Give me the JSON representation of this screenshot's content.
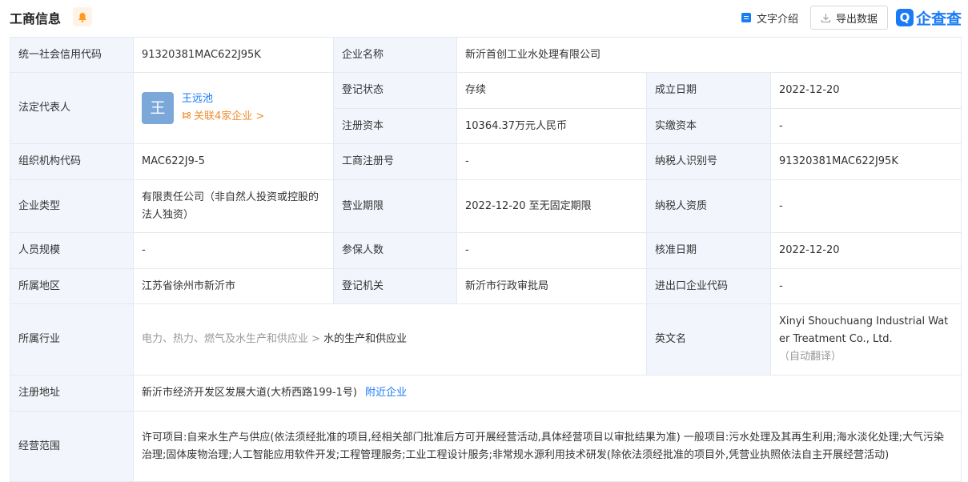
{
  "header": {
    "title": "工商信息",
    "text_intro_label": "文字介绍",
    "export_label": "导出数据",
    "logo_text": "企查查"
  },
  "colors": {
    "accent": "#1a7cf5",
    "label_bg": "#f2f6fc",
    "border": "#e4eaf3",
    "assoc": "#f08c2e"
  },
  "table": {
    "credit_code_label": "统一社会信用代码",
    "credit_code_value": "91320381MAC622J95K",
    "company_name_label": "企业名称",
    "company_name_value": "新沂首创工业水处理有限公司",
    "legal_rep_label": "法定代表人",
    "legal_rep_avatar": "王",
    "legal_rep_name": "王远池",
    "legal_rep_assoc": "关联4家企业 >",
    "reg_status_label": "登记状态",
    "reg_status_value": "存续",
    "found_date_label": "成立日期",
    "found_date_value": "2022-12-20",
    "reg_capital_label": "注册资本",
    "reg_capital_value": "10364.37万元人民币",
    "paid_capital_label": "实缴资本",
    "paid_capital_value": "-",
    "org_code_label": "组织机构代码",
    "org_code_value": "MAC622J9-5",
    "biz_reg_no_label": "工商注册号",
    "biz_reg_no_value": "-",
    "taxpayer_id_label": "纳税人识别号",
    "taxpayer_id_value": "91320381MAC622J95K",
    "company_type_label": "企业类型",
    "company_type_value": "有限责任公司（非自然人投资或控股的法人独资）",
    "biz_term_label": "营业期限",
    "biz_term_value": "2022-12-20 至无固定期限",
    "taxpayer_qual_label": "纳税人资质",
    "taxpayer_qual_value": "-",
    "staff_size_label": "人员规模",
    "staff_size_value": "-",
    "insured_label": "参保人数",
    "insured_value": "-",
    "approval_date_label": "核准日期",
    "approval_date_value": "2022-12-20",
    "region_label": "所属地区",
    "region_value": "江苏省徐州市新沂市",
    "reg_authority_label": "登记机关",
    "reg_authority_value": "新沂市行政审批局",
    "import_export_label": "进出口企业代码",
    "import_export_value": "-",
    "industry_label": "所属行业",
    "industry_parent": "电力、热力、燃气及水生产和供应业 >",
    "industry_value": "水的生产和供应业",
    "english_name_label": "英文名",
    "english_name_value": "Xinyi Shouchuang Industrial Water Treatment Co., Ltd.",
    "english_name_note": "（自动翻译）",
    "address_label": "注册地址",
    "address_value": "新沂市经济开发区发展大道(大桥西路199-1号)",
    "address_link": "附近企业",
    "scope_label": "经营范围",
    "scope_value": "许可项目:自来水生产与供应(依法须经批准的项目,经相关部门批准后方可开展经营活动,具体经营项目以审批结果为准) 一般项目:污水处理及其再生利用;海水淡化处理;大气污染治理;固体废物治理;人工智能应用软件开发;工程管理服务;工业工程设计服务;非常规水源利用技术研发(除依法须经批准的项目外,凭营业执照依法自主开展经营活动)"
  }
}
